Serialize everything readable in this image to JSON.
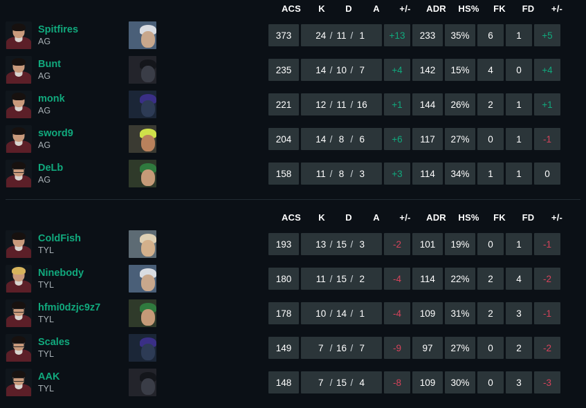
{
  "columns": {
    "headers": [
      "ACS",
      "K",
      "D",
      "A",
      "+/-",
      "ADR",
      "HS%",
      "FK",
      "FD",
      "+/-"
    ]
  },
  "colors": {
    "player_name": "#11a97d",
    "positive": "#11a97d",
    "negative": "#d6435b",
    "cell_bg": "#2b3539",
    "page_bg": "#0b1016"
  },
  "teams": [
    {
      "tag": "AG",
      "players": [
        {
          "name": "Spitfires",
          "team": "AG",
          "agent": "jett-agent-icon",
          "acs": "373",
          "k": "24",
          "d": "11",
          "a": "1",
          "kd_diff": "+13",
          "kd_sign": "pos",
          "adr": "233",
          "hs": "35%",
          "fk": "6",
          "fd": "1",
          "fkfd_diff": "+5",
          "fkfd_sign": "pos"
        },
        {
          "name": "Bunt",
          "team": "AG",
          "agent": "viper-agent-icon",
          "acs": "235",
          "k": "14",
          "d": "10",
          "a": "7",
          "kd_diff": "+4",
          "kd_sign": "pos",
          "adr": "142",
          "hs": "15%",
          "fk": "4",
          "fd": "0",
          "fkfd_diff": "+4",
          "fkfd_sign": "pos"
        },
        {
          "name": "monk",
          "team": "AG",
          "agent": "kayo-agent-icon",
          "acs": "221",
          "k": "12",
          "d": "11",
          "a": "16",
          "kd_diff": "+1",
          "kd_sign": "pos",
          "adr": "144",
          "hs": "26%",
          "fk": "2",
          "fd": "1",
          "fkfd_diff": "+1",
          "fkfd_sign": "pos"
        },
        {
          "name": "sword9",
          "team": "AG",
          "agent": "phoenix-agent-icon",
          "acs": "204",
          "k": "14",
          "d": "8",
          "a": "6",
          "kd_diff": "+6",
          "kd_sign": "pos",
          "adr": "117",
          "hs": "27%",
          "fk": "0",
          "fd": "1",
          "fkfd_diff": "-1",
          "fkfd_sign": "neg"
        },
        {
          "name": "DeLb",
          "team": "AG",
          "agent": "killjoy-agent-icon",
          "acs": "158",
          "k": "11",
          "d": "8",
          "a": "3",
          "kd_diff": "+3",
          "kd_sign": "pos",
          "adr": "114",
          "hs": "34%",
          "fk": "1",
          "fd": "1",
          "fkfd_diff": "0",
          "fkfd_sign": "zero"
        }
      ]
    },
    {
      "tag": "TYL",
      "players": [
        {
          "name": "ColdFish",
          "team": "TYL",
          "agent": "sova-agent-icon",
          "acs": "193",
          "k": "13",
          "d": "15",
          "a": "3",
          "kd_diff": "-2",
          "kd_sign": "neg",
          "adr": "101",
          "hs": "19%",
          "fk": "0",
          "fd": "1",
          "fkfd_diff": "-1",
          "fkfd_sign": "neg"
        },
        {
          "name": "Ninebody",
          "team": "TYL",
          "agent": "jett-agent-icon",
          "acs": "180",
          "k": "11",
          "d": "15",
          "a": "2",
          "kd_diff": "-4",
          "kd_sign": "neg",
          "adr": "114",
          "hs": "22%",
          "fk": "2",
          "fd": "4",
          "fkfd_diff": "-2",
          "fkfd_sign": "neg"
        },
        {
          "name": "hfmi0dzjc9z7",
          "team": "TYL",
          "agent": "killjoy-agent-icon",
          "acs": "178",
          "k": "10",
          "d": "14",
          "a": "1",
          "kd_diff": "-4",
          "kd_sign": "neg",
          "adr": "109",
          "hs": "31%",
          "fk": "2",
          "fd": "3",
          "fkfd_diff": "-1",
          "fkfd_sign": "neg"
        },
        {
          "name": "Scales",
          "team": "TYL",
          "agent": "kayo-agent-icon",
          "acs": "149",
          "k": "7",
          "d": "16",
          "a": "7",
          "kd_diff": "-9",
          "kd_sign": "neg",
          "adr": "97",
          "hs": "27%",
          "fk": "0",
          "fd": "2",
          "fkfd_diff": "-2",
          "fkfd_sign": "neg"
        },
        {
          "name": "AAK",
          "team": "TYL",
          "agent": "viper-agent-icon",
          "acs": "148",
          "k": "7",
          "d": "15",
          "a": "4",
          "kd_diff": "-8",
          "kd_sign": "neg",
          "adr": "109",
          "hs": "30%",
          "fk": "0",
          "fd": "3",
          "fkfd_diff": "-3",
          "fkfd_sign": "neg"
        }
      ]
    }
  ]
}
